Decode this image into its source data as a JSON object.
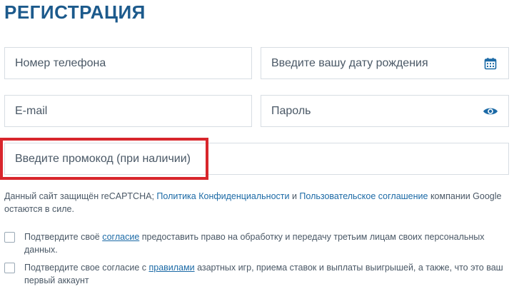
{
  "form": {
    "title": "РЕГИСТРАЦИЯ",
    "phone_placeholder": "Номер телефона",
    "birthdate_placeholder": "Введите вашу дату рождения",
    "email_placeholder": "E-mail",
    "password_placeholder": "Пароль",
    "promo_placeholder": "Введите промокод (при наличии)"
  },
  "icons": {
    "birthdate": "calendar-icon",
    "password": "eye-icon"
  },
  "colors": {
    "title": "#1c5a8c",
    "icon": "#1c6aa6",
    "link": "#1c6aa6",
    "highlight": "#d8262c"
  },
  "recaptcha": {
    "text_1": "Данный сайт защищён reCAPTCHA; ",
    "privacy_link": "Политика Конфиденциальности",
    "text_2": " и ",
    "terms_link": "Пользовательское соглашение",
    "text_3": " компании Google остаются в силе."
  },
  "consents": [
    {
      "text_1": "Подтвердите своё ",
      "link": "согласие",
      "text_2": " предоставить право на обработку и передачу третьим лицам своих персональных данных."
    },
    {
      "text_1": "Подтвердите свое согласие с ",
      "link": "правилами",
      "text_2": " азартных игр, приема ставок и выплаты выигрышей, а также, что это ваш первый аккаунт"
    }
  ]
}
